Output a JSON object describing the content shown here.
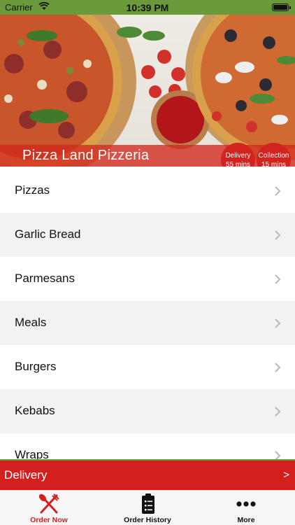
{
  "status_bar": {
    "carrier": "Carrier",
    "time": "10:39 PM"
  },
  "hero": {
    "restaurant_name": "Pizza Land Pizzeria",
    "delivery_badge": {
      "title": "Delivery",
      "time": "55 mins"
    },
    "collection_badge": {
      "title": "Collection",
      "time": "15 mins"
    }
  },
  "menu": {
    "items": [
      {
        "label": "Pizzas"
      },
      {
        "label": "Garlic Bread"
      },
      {
        "label": "Parmesans"
      },
      {
        "label": "Meals"
      },
      {
        "label": "Burgers"
      },
      {
        "label": "Kebabs"
      },
      {
        "label": "Wraps"
      }
    ]
  },
  "delivery_bar": {
    "label": "Delivery",
    "arrow": ">"
  },
  "tab_bar": {
    "tabs": [
      {
        "label": "Order Now",
        "icon": "fork-knife-icon",
        "active": true
      },
      {
        "label": "Order History",
        "icon": "clipboard-icon",
        "active": false
      },
      {
        "label": "More",
        "icon": "more-dots-icon",
        "active": false
      }
    ]
  },
  "colors": {
    "accent_red": "#d31f1d",
    "status_green": "#6a9a3a"
  }
}
